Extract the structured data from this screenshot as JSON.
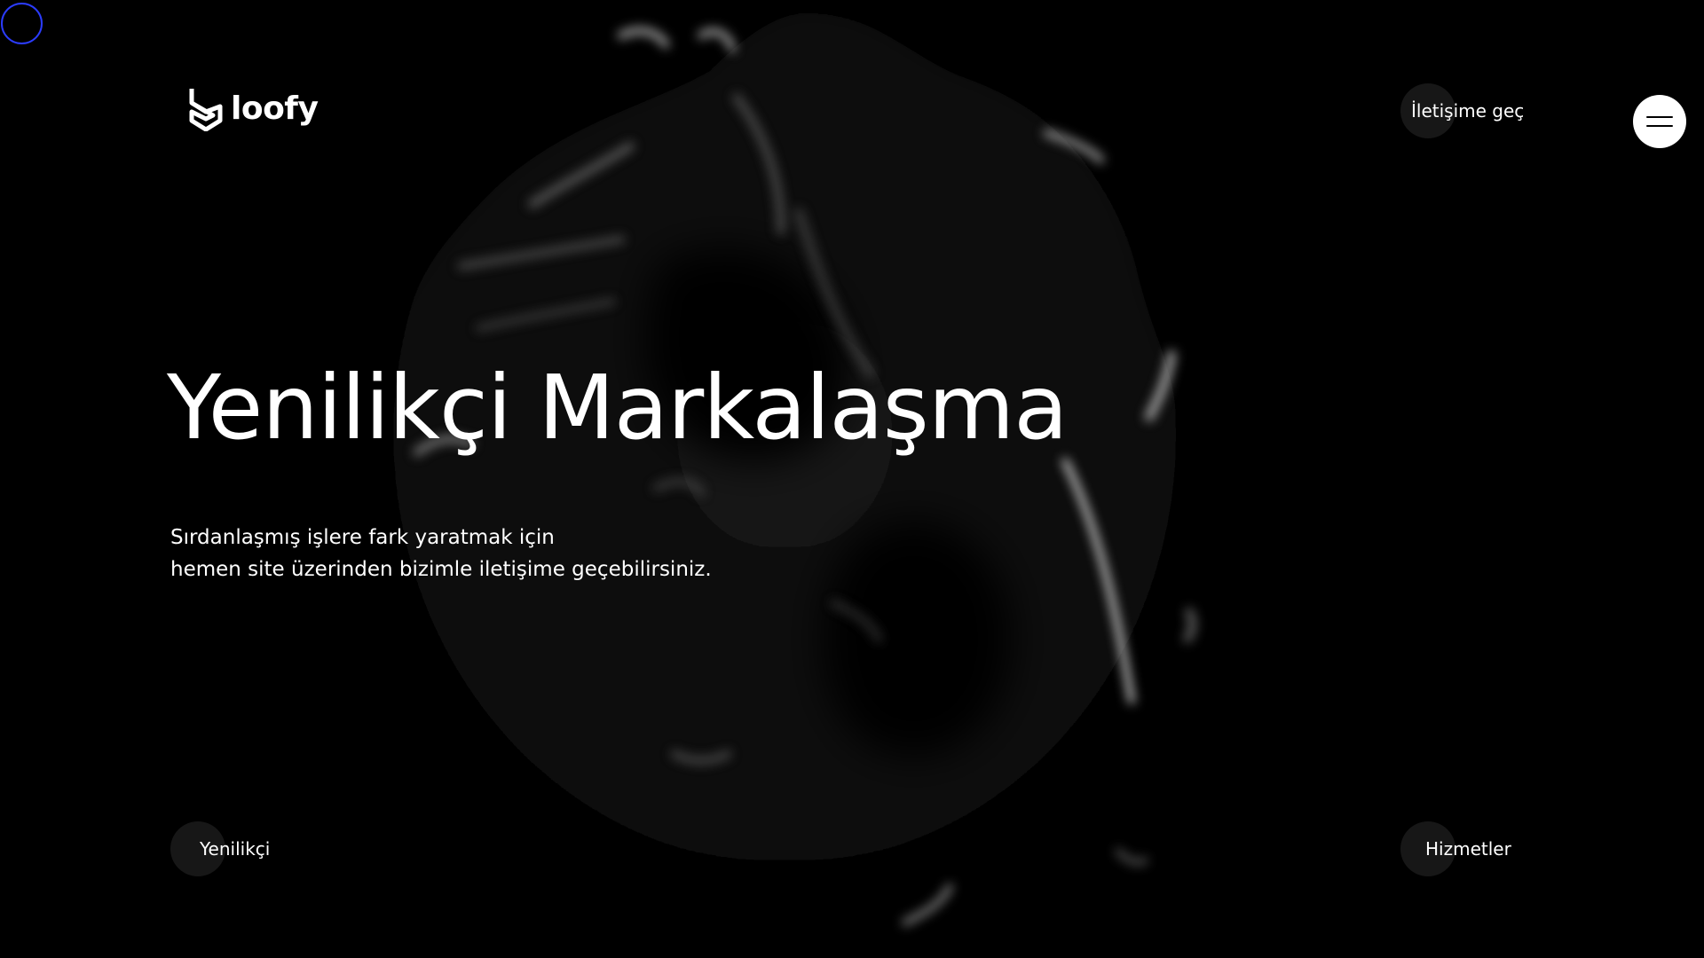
{
  "header": {
    "logo_text": "loofy",
    "contact_link": "İletişime geç",
    "menu_icon": "hamburger-menu-icon"
  },
  "hero": {
    "title": "Yenilikçi Markalaşma",
    "subtitle_line1": "Sırdanlaşmış işlere fark yaratmak için",
    "subtitle_line2": "hemen site üzerinden bizimle iletişime geçebilirsiniz."
  },
  "footer": {
    "left_link": "Yenilikçi",
    "right_link": "Hizmetler"
  },
  "colors": {
    "background": "#000000",
    "text": "#ffffff",
    "cursor_ring": "#2b3cff",
    "menu_button": "#ffffff"
  }
}
